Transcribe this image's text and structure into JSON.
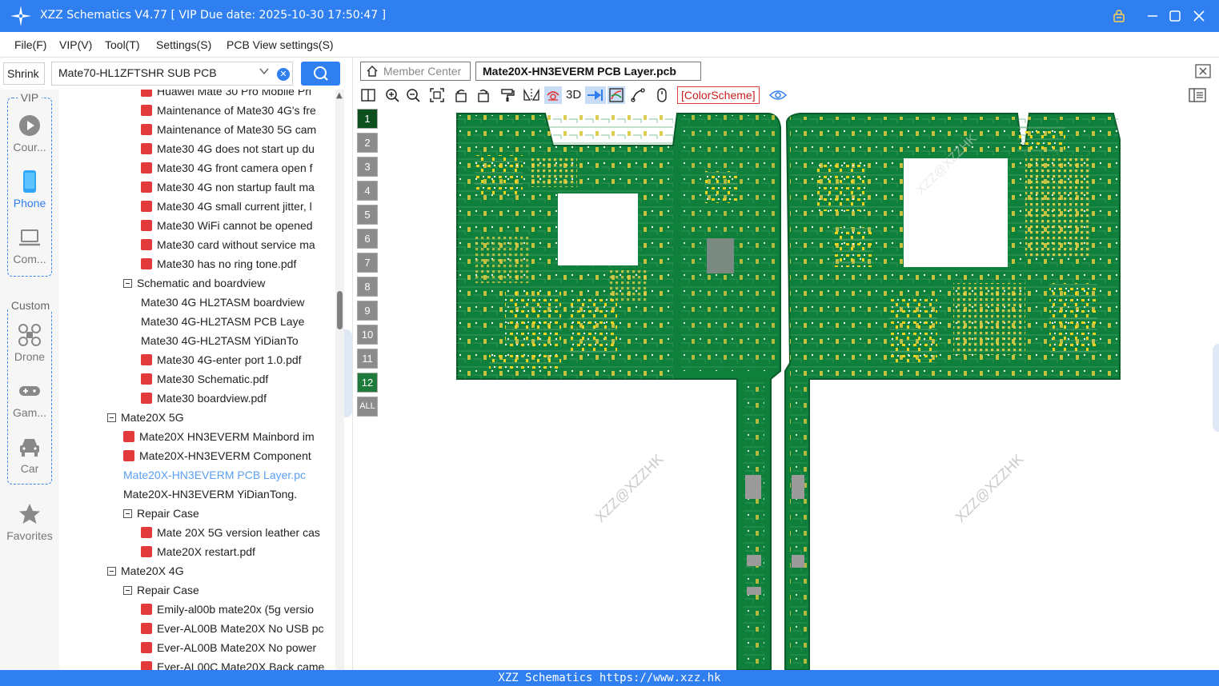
{
  "app": {
    "title": "XZZ Schematics V4.77 [ VIP Due date: 2025-10-30 17:50:47 ]"
  },
  "menu": [
    "File(F)",
    "VIP(V)",
    "Tool(T)",
    "Settings(S)",
    "PCB View settings(S)"
  ],
  "search": {
    "shrink_label": "Shrink",
    "value": "Mate70-HL1ZFTSHR SUB PCB"
  },
  "nav": {
    "vip_group_title": "VIP",
    "custom_group_title": "Custom",
    "items": [
      {
        "label": "Cour...",
        "icon": "play-icon"
      },
      {
        "label": "Phone",
        "icon": "phone-icon"
      },
      {
        "label": "Com...",
        "icon": "laptop-icon"
      },
      {
        "label": "Drone",
        "icon": "drone-icon"
      },
      {
        "label": "Gam...",
        "icon": "gamepad-icon"
      },
      {
        "label": "Car",
        "icon": "car-icon"
      },
      {
        "label": "Favorites",
        "icon": "star-icon"
      }
    ]
  },
  "tree": [
    {
      "label": "Huawei Mate 30 Pro Mobile Pri",
      "type": "pdf",
      "level": 2
    },
    {
      "label": "Maintenance of Mate30 4G's fre",
      "type": "pdf",
      "level": 2
    },
    {
      "label": "Maintenance of Mate30 5G cam",
      "type": "pdf",
      "level": 2
    },
    {
      "label": "Mate30 4G does not start up du",
      "type": "pdf",
      "level": 2
    },
    {
      "label": "Mate30 4G front camera open f",
      "type": "pdf",
      "level": 2
    },
    {
      "label": "Mate30 4G non startup fault ma",
      "type": "pdf",
      "level": 2
    },
    {
      "label": "Mate30 4G small current jitter, l",
      "type": "pdf",
      "level": 2
    },
    {
      "label": "Mate30 WiFi cannot be opened",
      "type": "pdf",
      "level": 2
    },
    {
      "label": "Mate30 card without service ma",
      "type": "pdf",
      "level": 2
    },
    {
      "label": "Mate30 has no ring tone.pdf",
      "type": "pdf",
      "level": 2
    },
    {
      "label": "Schematic and boardview",
      "type": "folder",
      "level": 1
    },
    {
      "label": "Mate30 4G HL2TASM boardview",
      "type": "pcb",
      "level": 2
    },
    {
      "label": "Mate30 4G-HL2TASM PCB Laye",
      "type": "pcb",
      "level": 2
    },
    {
      "label": "Mate30 4G-HL2TASM YiDianTo",
      "type": "pcb",
      "level": 2
    },
    {
      "label": "Mate30 4G-enter port 1.0.pdf",
      "type": "pdf",
      "level": 2
    },
    {
      "label": "Mate30 Schematic.pdf",
      "type": "pdf",
      "level": 2
    },
    {
      "label": "Mate30 boardview.pdf",
      "type": "pdf",
      "level": 2
    },
    {
      "label": "Mate20X 5G",
      "type": "folder",
      "level": 0
    },
    {
      "label": "Mate20X HN3EVERM Mainbord im",
      "type": "pdf",
      "level": 1
    },
    {
      "label": "Mate20X-HN3EVERM Component",
      "type": "pdf",
      "level": 1
    },
    {
      "label": "Mate20X-HN3EVERM PCB Layer.pc",
      "type": "pcb",
      "level": 1,
      "selected": true
    },
    {
      "label": "Mate20X-HN3EVERM YiDianTong.",
      "type": "pcb",
      "level": 1
    },
    {
      "label": "Repair Case",
      "type": "folder",
      "level": 1
    },
    {
      "label": "Mate 20X 5G version leather cas",
      "type": "pdf",
      "level": 2
    },
    {
      "label": "Mate20X restart.pdf",
      "type": "pdf",
      "level": 2
    },
    {
      "label": "Mate20X 4G",
      "type": "folder",
      "level": 0
    },
    {
      "label": "Repair Case",
      "type": "folder",
      "level": 1
    },
    {
      "label": "Emily-al00b mate20x (5g versio",
      "type": "pdf",
      "level": 2
    },
    {
      "label": "Ever-AL00B Mate20X No USB pc",
      "type": "pdf",
      "level": 2
    },
    {
      "label": "Ever-AL00B Mate20X No power",
      "type": "pdf",
      "level": 2
    },
    {
      "label": "Ever-AL00C Mate20X Back came",
      "type": "pdf",
      "level": 2
    }
  ],
  "tabs": {
    "member": "Member Center",
    "active": "Mate20X-HN3EVERM PCB Layer.pcb"
  },
  "toolbar": {
    "three_d": "3D",
    "color_scheme": "[ColorScheme]"
  },
  "layers": [
    "1",
    "2",
    "3",
    "4",
    "5",
    "6",
    "7",
    "8",
    "9",
    "10",
    "11",
    "12",
    "ALL"
  ],
  "layers_on": [
    "1",
    "12"
  ],
  "watermark": "XZZ@XZZHK",
  "status": "XZZ Schematics https://www.xzz.hk",
  "colors": {
    "accent": "#2f7ff0",
    "pcb_green": "#0f7f3c",
    "pad_yellow": "#f2d31b"
  }
}
